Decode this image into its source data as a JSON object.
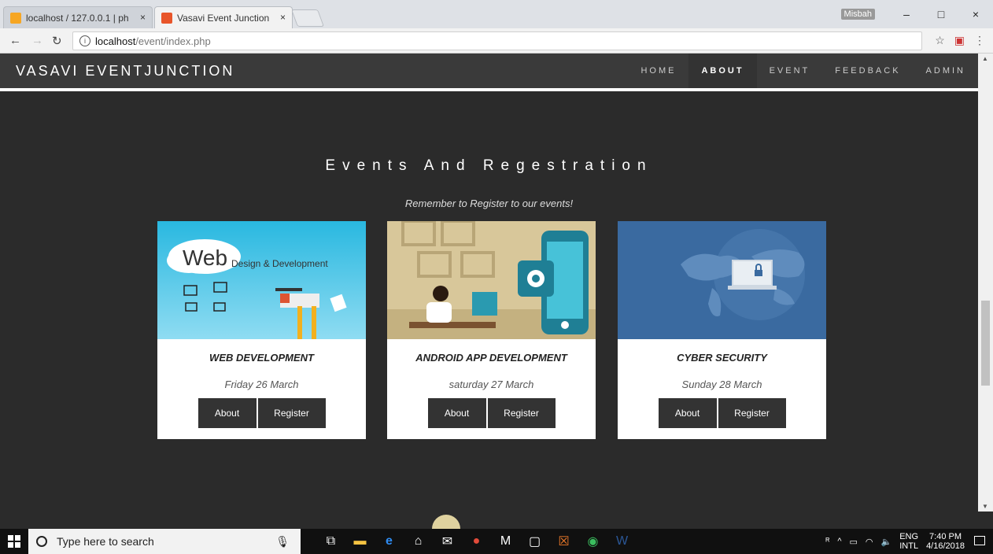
{
  "browser": {
    "tabs": [
      {
        "title": "localhost / 127.0.0.1 | ph",
        "close": "×"
      },
      {
        "title": "Vasavi Event Junction",
        "close": "×"
      }
    ],
    "user_label": "Misbah",
    "url_host": "localhost",
    "url_path": "/event/index.php",
    "window_controls": [
      "–",
      "□",
      "×"
    ]
  },
  "site": {
    "brand": "VASAVI EVENTJUNCTION",
    "nav": [
      "HOME",
      "ABOUT",
      "EVENT",
      "FEEDBACK",
      "ADMIN"
    ],
    "active_nav": "ABOUT",
    "section_title": "Events And Regestration",
    "section_subtitle": "Remember to Register to our events!",
    "events": [
      {
        "title": "WEB DEVELOPMENT",
        "date": "Friday 26 March",
        "about_label": "About",
        "register_label": "Register",
        "image_text_main": "Web",
        "image_text_sub": "Design & Development"
      },
      {
        "title": "ANDROID APP DEVELOPMENT",
        "date": "saturday 27 March",
        "about_label": "About",
        "register_label": "Register"
      },
      {
        "title": "CYBER SECURITY",
        "date": "Sunday 28 March",
        "about_label": "About",
        "register_label": "Register"
      }
    ]
  },
  "taskbar": {
    "search_placeholder": "Type here to search",
    "lang_top": "ENG",
    "lang_bottom": "INTL",
    "time": "7:40 PM",
    "date": "4/16/2018"
  },
  "colors": {
    "page_bg": "#2b2b2b",
    "navbar_bg": "#3a3a3a",
    "card_bg": "#ffffff",
    "button_bg": "#333333",
    "web_img_bg": "#3fc3e6",
    "android_img_bg": "#d8c79a",
    "cyber_img_bg": "#3a6aa0"
  }
}
